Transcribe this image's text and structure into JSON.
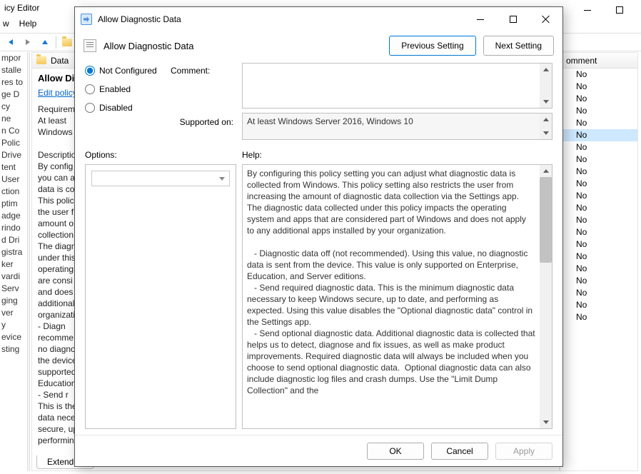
{
  "bg": {
    "app_title_fragment": "icy Editor",
    "menus": [
      "w",
      "Help"
    ],
    "left_items": [
      "mpor",
      "stalle",
      "res to",
      "ge D",
      "cy",
      "ne",
      "n Co",
      "Polic",
      "",
      "Drive",
      "",
      "tent",
      "",
      "User",
      "ction",
      "ptim",
      "adge",
      "rindo",
      "d Dri",
      "gistra",
      "ker",
      "",
      "vardi",
      "Serv",
      "ging",
      "ver",
      "y",
      "evice",
      "sting"
    ],
    "folder_label": "Data",
    "mid_title": "Allow Di",
    "edit_label": "Edit",
    "edit_link": "policy",
    "req_label": "Requirem",
    "req_line1": "At least",
    "req_line2": "Windows",
    "desc_label": "Descriptio",
    "desc_lines": [
      "By config",
      "you can a",
      "data is col",
      "This polic",
      "the user f",
      "amount o",
      "collection",
      "The diagn",
      "under this",
      "operating",
      "are consi",
      "and does",
      "additional",
      "organizati",
      "",
      "   - Diagn",
      "recomme",
      "no diagno",
      "the device",
      "supported",
      "Education",
      "   - Send r",
      "This is the",
      "data nece",
      "secure, up",
      "performin"
    ],
    "tab_extended": "Extended",
    "right_header": "omment",
    "right_rows": [
      "No",
      "No",
      "No",
      "No",
      "No",
      "No",
      "No",
      "No",
      "No",
      "No",
      "No",
      "No",
      "No",
      "No",
      "No",
      "No",
      "No",
      "No",
      "No",
      "No",
      "No"
    ],
    "selected_row_index": 5
  },
  "dlg": {
    "window_title": "Allow Diagnostic Data",
    "toolbar_title": "Allow Diagnostic Data",
    "prev_btn": "Previous Setting",
    "next_btn": "Next Setting",
    "radio_notconfigured": "Not Configured",
    "radio_enabled": "Enabled",
    "radio_disabled": "Disabled",
    "selected_radio": "notconfigured",
    "lbl_comment": "Comment:",
    "comment_value": "",
    "lbl_supported": "Supported on:",
    "supported_value": "At least Windows Server 2016, Windows 10",
    "lbl_options": "Options:",
    "lbl_help": "Help:",
    "options_value": "",
    "help_text": "By configuring this policy setting you can adjust what diagnostic data is collected from Windows. This policy setting also restricts the user from increasing the amount of diagnostic data collection via the Settings app. The diagnostic data collected under this policy impacts the operating system and apps that are considered part of Windows and does not apply to any additional apps installed by your organization.\n\n   - Diagnostic data off (not recommended). Using this value, no diagnostic data is sent from the device. This value is only supported on Enterprise, Education, and Server editions.\n   - Send required diagnostic data. This is the minimum diagnostic data necessary to keep Windows secure, up to date, and performing as expected. Using this value disables the \"Optional diagnostic data\" control in the Settings app.\n   - Send optional diagnostic data. Additional diagnostic data is collected that helps us to detect, diagnose and fix issues, as well as make product improvements. Required diagnostic data will always be included when you choose to send optional diagnostic data.  Optional diagnostic data can also include diagnostic log files and crash dumps. Use the \"Limit Dump Collection\" and the",
    "btn_ok": "OK",
    "btn_cancel": "Cancel",
    "btn_apply": "Apply"
  }
}
